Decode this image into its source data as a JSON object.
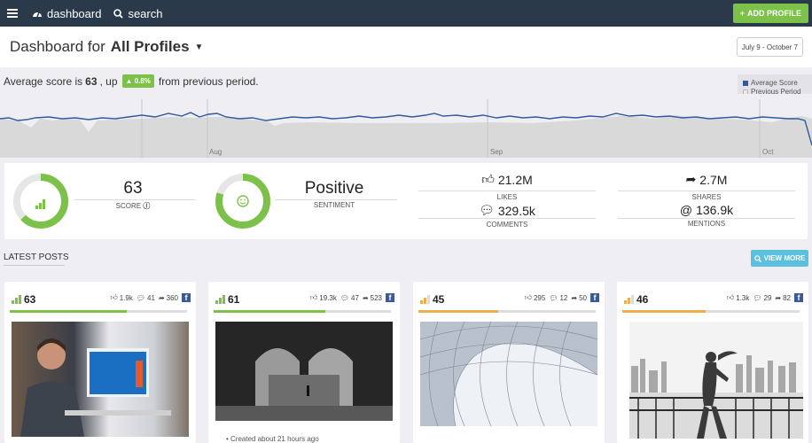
{
  "topbar": {
    "dashboard_label": "dashboard",
    "search_label": "search",
    "add_profile_label": "ADD PROFILE"
  },
  "header": {
    "title_prefix": "Dashboard for",
    "profile": "All Profiles",
    "date_range": "July 9 - October 7"
  },
  "summary": {
    "prefix": "Average score is",
    "score": "63",
    "mid": ", up",
    "change": "0.8%",
    "suffix": "from previous period."
  },
  "legend": {
    "current": "Average Score",
    "previous": "Previous Period"
  },
  "timeline": {
    "labels": [
      "Aug",
      "Sep",
      "Oct"
    ]
  },
  "colors": {
    "topbar": "#2b3a4a",
    "green": "#7cc14a",
    "blue_line": "#2f5aa0",
    "orange": "#f0ad4e",
    "cyan": "#5bc0de",
    "facebook": "#3b5998"
  },
  "stats": {
    "score": {
      "value": "63",
      "label": "SCORE",
      "fraction": 0.63
    },
    "sentiment": {
      "value": "Positive",
      "label": "SENTIMENT",
      "fraction": 0.8
    },
    "likes": {
      "value": "21.2M",
      "label": "LIKES"
    },
    "comments": {
      "value": "329.5k",
      "label": "COMMENTS"
    },
    "shares": {
      "value": "2.7M",
      "label": "SHARES"
    },
    "mentions": {
      "value": "136.9k",
      "label": "MENTIONS",
      "prefix": "@"
    }
  },
  "latest": {
    "title": "LATEST POSTS",
    "view_more": "VIEW MORE"
  },
  "posts": [
    {
      "score": "63",
      "likes": "1.9k",
      "comments": "41",
      "shares": "360",
      "fraction": 0.66,
      "color": "#7cc14a"
    },
    {
      "score": "61",
      "likes": "19.3k",
      "comments": "47",
      "shares": "523",
      "fraction": 0.63,
      "color": "#7cc14a",
      "note": "Created about 21 hours ago"
    },
    {
      "score": "45",
      "likes": "295",
      "comments": "12",
      "shares": "50",
      "fraction": 0.45,
      "color": "#f0ad4e"
    },
    {
      "score": "46",
      "likes": "1.3k",
      "comments": "29",
      "shares": "82",
      "fraction": 0.47,
      "color": "#f0ad4e"
    }
  ]
}
